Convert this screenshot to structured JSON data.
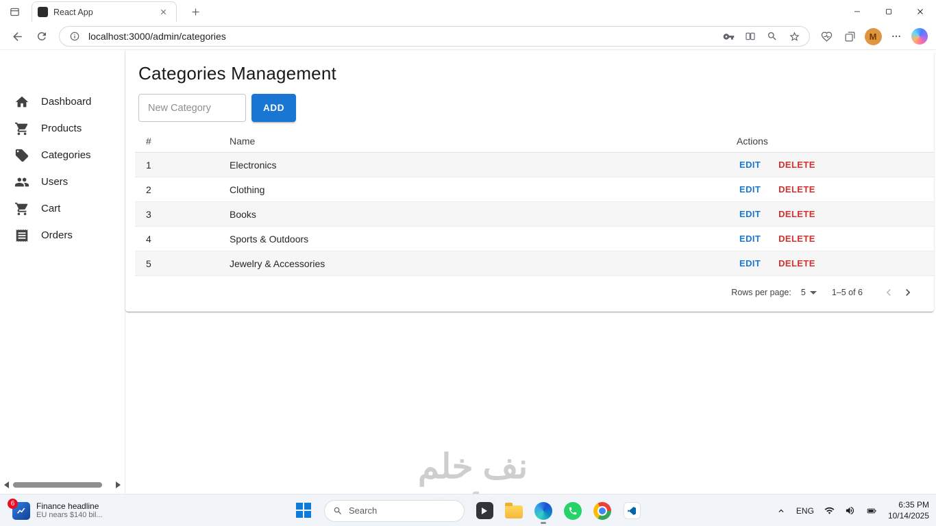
{
  "browser": {
    "tab_title": "React App",
    "url": "localhost:3000/admin/categories",
    "profile_initial": "M"
  },
  "sidebar": {
    "items": [
      {
        "label": "Dashboard"
      },
      {
        "label": "Products"
      },
      {
        "label": "Categories"
      },
      {
        "label": "Users"
      },
      {
        "label": "Cart"
      },
      {
        "label": "Orders"
      }
    ]
  },
  "main": {
    "title": "Categories Management",
    "form": {
      "placeholder": "New Category",
      "add_label": "ADD"
    },
    "table": {
      "headers": {
        "num": "#",
        "name": "Name",
        "actions": "Actions"
      },
      "rows": [
        {
          "num": "1",
          "name": "Electronics"
        },
        {
          "num": "2",
          "name": "Clothing"
        },
        {
          "num": "3",
          "name": "Books"
        },
        {
          "num": "4",
          "name": "Sports & Outdoors"
        },
        {
          "num": "5",
          "name": "Jewelry & Accessories"
        }
      ],
      "edit_label": "EDIT",
      "delete_label": "DELETE"
    },
    "pagination": {
      "rows_per_page_label": "Rows per page:",
      "rows_per_page_value": "5",
      "range": "1–5 of 6"
    }
  },
  "watermark": {
    "line1": "نف خلم",
    "line2": "oofez"
  },
  "taskbar": {
    "widget": {
      "badge": "6",
      "title": "Finance headline",
      "subtitle": "EU nears $140 bil..."
    },
    "search_placeholder": "Search",
    "tray": {
      "language": "ENG",
      "time": "6:35 PM",
      "date": "10/14/2025"
    }
  },
  "colors": {
    "primary": "#1976d2",
    "danger": "#d32f2f"
  }
}
